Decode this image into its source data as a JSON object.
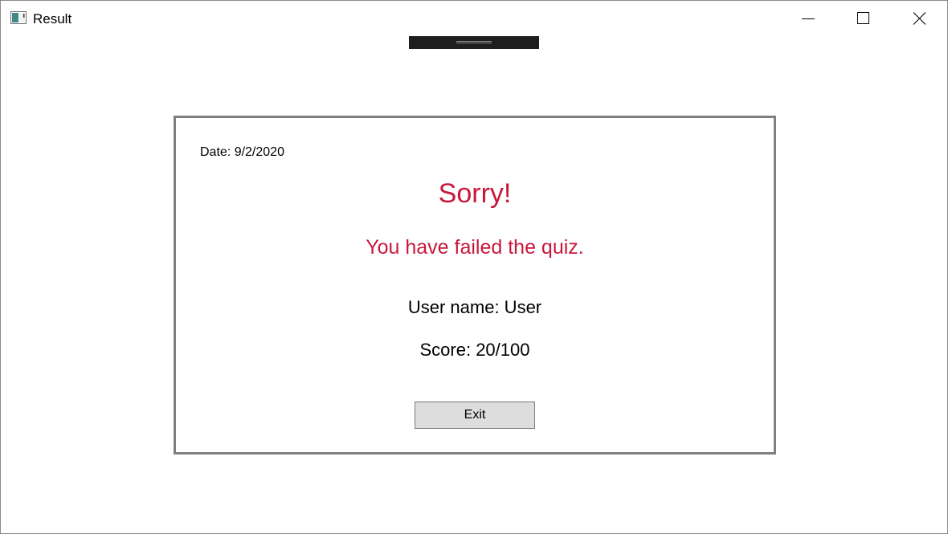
{
  "window": {
    "title": "Result",
    "icon": "app-window-icon",
    "controls": {
      "minimize_icon": "minimize-icon",
      "maximize_icon": "maximize-icon",
      "close_icon": "close-icon"
    }
  },
  "result": {
    "date": "Date: 9/2/2020",
    "heading": "Sorry!",
    "message": "You have failed the quiz.",
    "user_name": "User name: User",
    "score": "Score: 20/100",
    "exit_label": "Exit"
  },
  "colors": {
    "failure_text": "#c8183c",
    "card_border": "#7f7f7f",
    "button_background": "#dddddd"
  }
}
